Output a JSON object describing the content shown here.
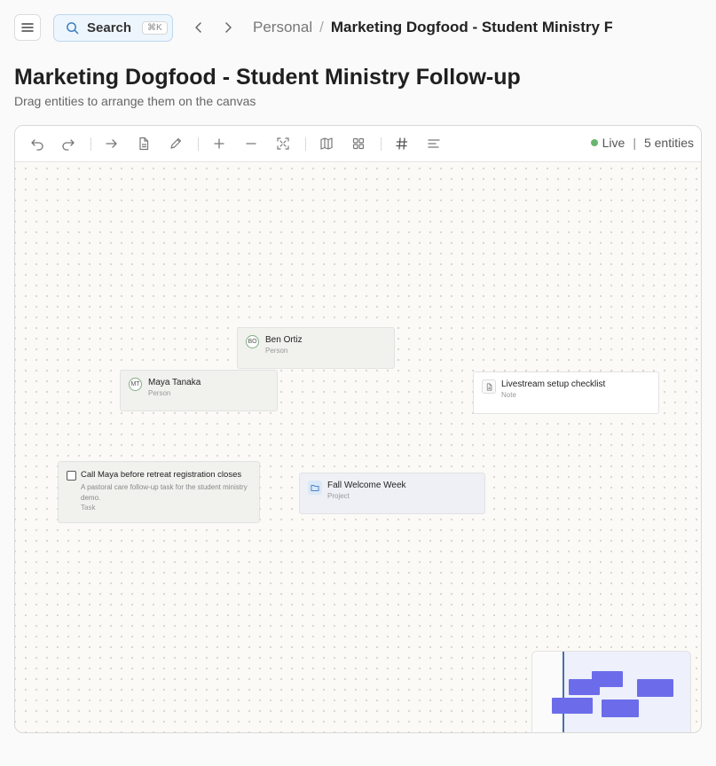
{
  "header": {
    "search_label": "Search",
    "search_shortcut": "⌘K",
    "breadcrumb_root": "Personal",
    "breadcrumb_separator": "/",
    "breadcrumb_current": "Marketing Dogfood - Student Ministry Follow-up"
  },
  "page": {
    "title": "Marketing Dogfood - Student Ministry Follow-up",
    "subtitle": "Drag entities to arrange them on the canvas"
  },
  "toolbar": {
    "status_live": "Live",
    "status_separator": "|",
    "status_count": "5 entities",
    "live_color": "#6ab46f",
    "icons": [
      "undo-icon",
      "redo-icon",
      "arrow-right-icon",
      "document-icon",
      "pencil-icon",
      "plus-icon",
      "minus-icon",
      "fit-screen-icon",
      "map-icon",
      "grid-icon",
      "hash-icon",
      "align-left-icon"
    ]
  },
  "entities": {
    "ben": {
      "initials": "BO",
      "name": "Ben Ortiz",
      "type": "Person"
    },
    "maya": {
      "initials": "MT",
      "name": "Maya Tanaka",
      "type": "Person"
    },
    "note": {
      "icon": "document-icon",
      "name": "Livestream setup checklist",
      "type": "Note"
    },
    "task": {
      "name": "Call Maya before retreat registration closes",
      "description": "A pastoral care follow-up task for the student ministry demo.",
      "type": "Task"
    },
    "project": {
      "icon": "folder-icon",
      "name": "Fall Welcome Week",
      "type": "Project"
    }
  },
  "colors": {
    "accent": "#6c6cea",
    "person_card_bg": "#f1f1ee",
    "project_card_bg": "#eef0f5"
  }
}
